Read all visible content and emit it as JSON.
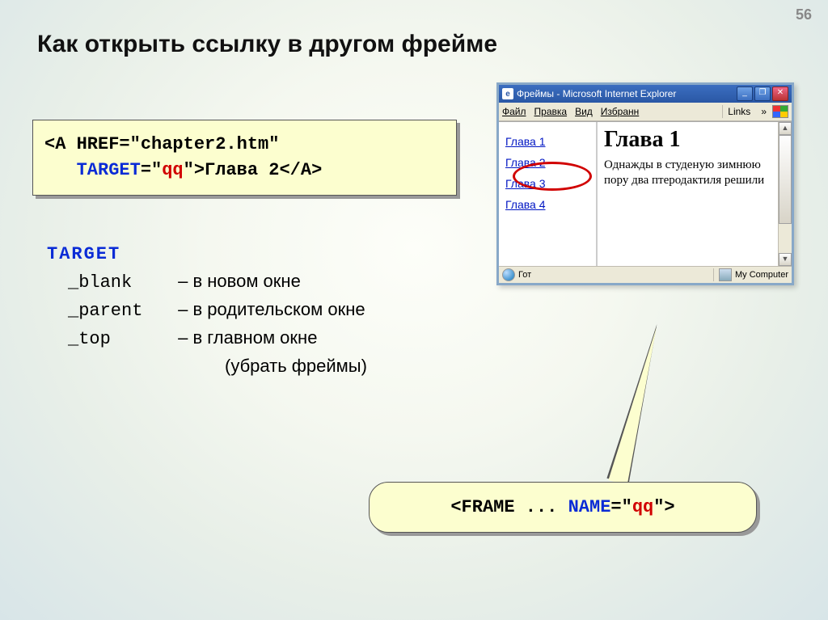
{
  "page_number": "56",
  "title": "Как открыть ссылку в другом фрейме",
  "code1": {
    "line1_pre": "<A HREF=\"chapter2.htm\"",
    "target_attr": "TARGET",
    "eq_open": "=\"",
    "qq": "qq",
    "close_quote": "\"",
    "gt": ">",
    "linktext": "Глава 2",
    "close_tag": "</A>"
  },
  "target_list": {
    "header": "TARGET",
    "blank_k": "_blank",
    "blank_d": " – в новом окне",
    "parent_k": "_parent",
    "parent_d": " – в родительском окне",
    "top_k": "_top",
    "top_d": " – в главном окне",
    "top_d2": "(убрать фреймы)"
  },
  "bubble": {
    "frame": "<FRAME ...",
    "name_attr": "NAME",
    "eq_open": "=\"",
    "qq": "qq",
    "close": "\">"
  },
  "ie": {
    "title": "Фреймы - Microsoft Internet Explorer",
    "menu": {
      "file": "Файл",
      "edit": "Правка",
      "view": "Вид",
      "fav": "Избранн",
      "links": "Links",
      "chev": "»"
    },
    "nav": {
      "l1": "Глава 1",
      "l2": "Глава 2",
      "l3": "Глава 3",
      "l4": "Глава 4"
    },
    "content": {
      "head": "Глава 1",
      "body": "Однажды в студеную зимнюю пору два птеродактиля решили"
    },
    "status": {
      "done": "Гот",
      "mc": "My Computer"
    }
  }
}
